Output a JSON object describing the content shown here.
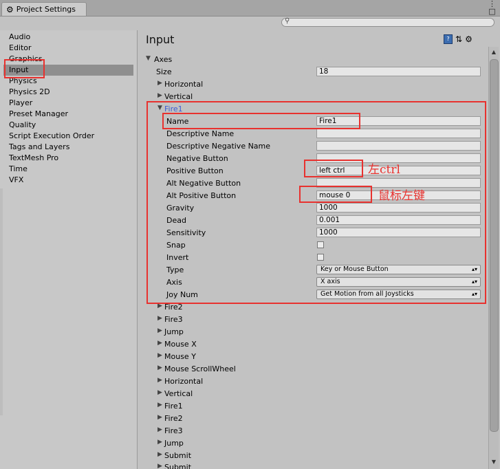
{
  "window": {
    "tab_title": "Project Settings",
    "controls": [
      "⋮",
      "□",
      "×"
    ],
    "search": {
      "placeholder": ""
    }
  },
  "sidebar": {
    "items": [
      {
        "label": "Audio",
        "selected": false
      },
      {
        "label": "Editor",
        "selected": false
      },
      {
        "label": "Graphics",
        "selected": false
      },
      {
        "label": "Input",
        "selected": true
      },
      {
        "label": "Physics",
        "selected": false
      },
      {
        "label": "Physics 2D",
        "selected": false
      },
      {
        "label": "Player",
        "selected": false
      },
      {
        "label": "Preset Manager",
        "selected": false
      },
      {
        "label": "Quality",
        "selected": false
      },
      {
        "label": "Script Execution Order",
        "selected": false
      },
      {
        "label": "Tags and Layers",
        "selected": false
      },
      {
        "label": "TextMesh Pro",
        "selected": false
      },
      {
        "label": "Time",
        "selected": false
      },
      {
        "label": "VFX",
        "selected": false
      }
    ]
  },
  "main": {
    "title": "Input",
    "header_icons": [
      "help-book-icon",
      "preset-sliders-icon",
      "settings-gear-icon"
    ],
    "axes_label": "Axes",
    "size_label": "Size",
    "size_value": "18",
    "collapsed_before": [
      "Horizontal",
      "Vertical"
    ],
    "fire1": {
      "label": "Fire1",
      "name_label": "Name",
      "name_value": "Fire1",
      "desc_label": "Descriptive Name",
      "desc_value": "",
      "desc_neg_label": "Descriptive Negative Name",
      "desc_neg_value": "",
      "neg_label": "Negative Button",
      "neg_value": "",
      "pos_label": "Positive Button",
      "pos_value": "left ctrl",
      "alt_neg_label": "Alt Negative Button",
      "alt_neg_value": "",
      "alt_pos_label": "Alt Positive Button",
      "alt_pos_value": "mouse 0",
      "gravity_label": "Gravity",
      "gravity_value": "1000",
      "dead_label": "Dead",
      "dead_value": "0.001",
      "sens_label": "Sensitivity",
      "sens_value": "1000",
      "snap_label": "Snap",
      "snap_checked": false,
      "invert_label": "Invert",
      "invert_checked": false,
      "type_label": "Type",
      "type_value": "Key or Mouse Button",
      "axis_label": "Axis",
      "axis_value": "X axis",
      "joy_label": "Joy Num",
      "joy_value": "Get Motion from all Joysticks"
    },
    "collapsed_after": [
      "Fire2",
      "Fire3",
      "Jump",
      "Mouse X",
      "Mouse Y",
      "Mouse ScrollWheel",
      "Horizontal",
      "Vertical",
      "Fire1",
      "Fire2",
      "Fire3",
      "Jump",
      "Submit",
      "Submit"
    ]
  },
  "annotations": {
    "left_ctrl_note": "左ctrl",
    "left_mouse_note": "鼠标左键",
    "color": "#e8312e"
  }
}
